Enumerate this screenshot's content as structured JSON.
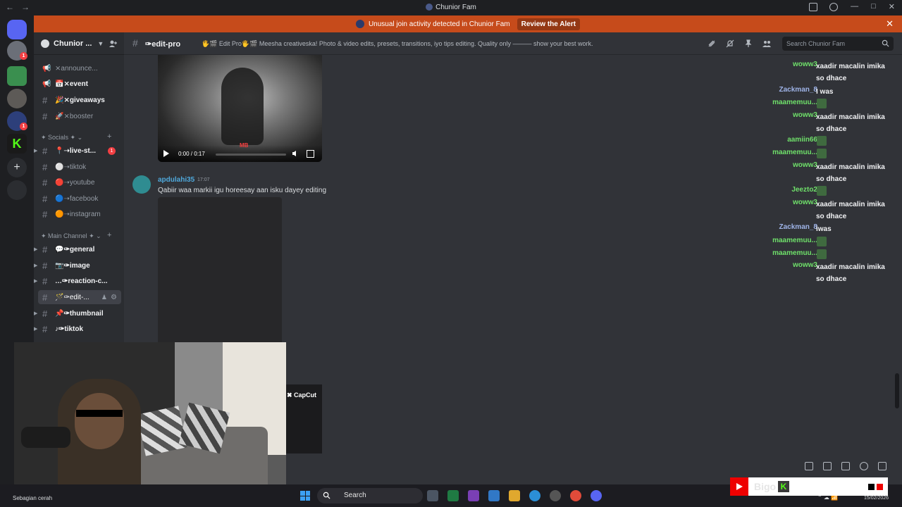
{
  "window": {
    "title": "Chunior Fam"
  },
  "alert": {
    "text": "Unusual join activity detected in Chunior Fam",
    "action": "Review the Alert"
  },
  "server": {
    "name": "Chunior ..."
  },
  "sidebar": {
    "channels_top": [
      {
        "label": "⨯announce...",
        "type": "announce"
      },
      {
        "label": "📅⨯event",
        "type": "announce"
      },
      {
        "label": "🎉⨯giveaways",
        "type": "text"
      },
      {
        "label": "🚀⨯booster",
        "type": "text"
      }
    ],
    "category_socials": "✦ Socials ✦",
    "channels_socials": [
      {
        "label": "📍➝live-st...",
        "badge": "1"
      },
      {
        "label": "⚪➝tiktok"
      },
      {
        "label": "🔴➝youtube"
      },
      {
        "label": "🔵➝facebook"
      },
      {
        "label": "🟠➝instagram"
      }
    ],
    "category_main": "✦ Main Channel ✦",
    "channels_main": [
      {
        "label": "💬✑general"
      },
      {
        "label": "📷✑image"
      },
      {
        "label": "…✑reaction-c..."
      },
      {
        "label": "🪄✑edit-...",
        "active": true
      },
      {
        "label": "📌✑thumbnail"
      },
      {
        "label": "♪✑tiktok"
      }
    ]
  },
  "channel_header": {
    "name": "✑edit-pro",
    "topic": "🖐🎬 Edit Pro🖐🎬 Meesha creativeska! Photo & video edits, presets, transitions, iyo tips editing. Quality only ——— show your best work.",
    "search_placeholder": "Search Chunior Fam"
  },
  "video": {
    "time": "0:00 / 0:17",
    "progress": 0.0,
    "watermark": "MB"
  },
  "message": {
    "author": "apdulahi35",
    "timestamp": "17:07",
    "text": "Qabiir waa markii igu horeesay aan isku dayey editing"
  },
  "capcut_label": "CapCut",
  "overlay_chat": [
    {
      "user": "woww3",
      "color": "green",
      "lines": [
        "xaadir macalin imika",
        "so dhace"
      ]
    },
    {
      "user": "Zackman_8",
      "color": "blue",
      "lines": [
        "I was"
      ]
    },
    {
      "user": "maamemuu...",
      "color": "green",
      "emote": true
    },
    {
      "user": "woww3",
      "color": "green",
      "lines": [
        "xaadir macalin imika",
        "so dhace"
      ]
    },
    {
      "user": "aamiin66",
      "color": "green",
      "emote": true
    },
    {
      "user": "maamemuu...",
      "color": "green",
      "emote": true
    },
    {
      "user": "woww3",
      "color": "green",
      "lines": [
        "xaadir macalin imika",
        "so dhace"
      ]
    },
    {
      "user": "Jeezto2",
      "color": "green",
      "emote": true
    },
    {
      "user": "woww3",
      "color": "green",
      "lines": [
        "xaadir macalin imika",
        "so dhace"
      ]
    },
    {
      "user": "Zackman_8",
      "color": "blue",
      "lines": [
        "iwas"
      ]
    },
    {
      "user": "maamemuu...",
      "color": "green",
      "emote": true
    },
    {
      "user": "maamemuu...",
      "color": "green",
      "emote": true
    },
    {
      "user": "woww3",
      "color": "green",
      "lines": [
        "xaadir macalin imika",
        "so dhace"
      ]
    }
  ],
  "taskbar": {
    "weather": "Sebagian cerah",
    "search": "Search",
    "date": "15/02/2026"
  },
  "stream_badge": {
    "handle": "Bigo",
    "k_icon": "K"
  },
  "colors": {
    "alert": "#c64b1b",
    "accent_green": "#6fe06a",
    "accent_blue": "#9fb4e8",
    "mention_red": "#f23f43"
  }
}
